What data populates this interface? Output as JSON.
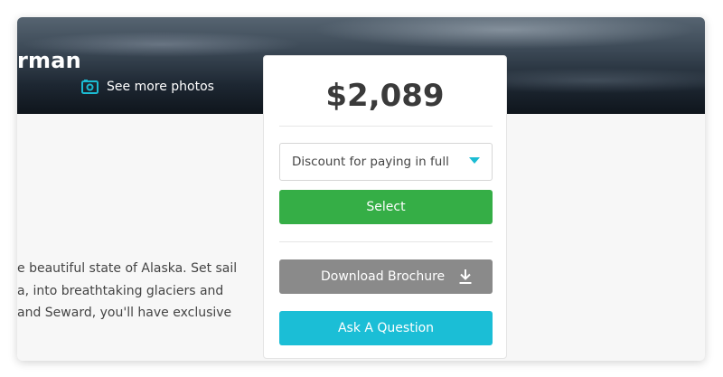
{
  "hero": {
    "title_partial": "rman",
    "photos_link_label": "See more photos"
  },
  "description": {
    "lines": [
      "e beautiful state of Alaska. Set sail",
      "a, into breathtaking glaciers and",
      "and Seward, you'll have exclusive"
    ]
  },
  "booking": {
    "price": "$2,089",
    "payment_option": {
      "selected": "Discount for paying in full"
    },
    "select_label": "Select",
    "download_label": "Download Brochure",
    "ask_label": "Ask A Question"
  },
  "colors": {
    "select_button": "#35ae46",
    "download_button": "#8a8a8a",
    "ask_button": "#1bbed6",
    "accent": "#1bbcd3"
  },
  "icons": {
    "photos": "camera-icon",
    "dropdown": "caret-down-icon",
    "download": "download-icon"
  }
}
